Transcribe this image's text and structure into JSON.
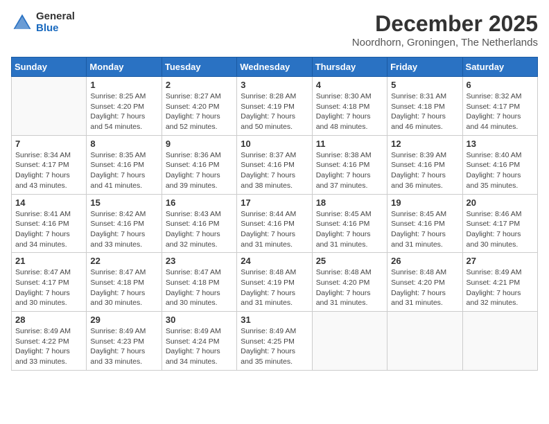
{
  "logo": {
    "general": "General",
    "blue": "Blue"
  },
  "title": "December 2025",
  "subtitle": "Noordhorn, Groningen, The Netherlands",
  "days_of_week": [
    "Sunday",
    "Monday",
    "Tuesday",
    "Wednesday",
    "Thursday",
    "Friday",
    "Saturday"
  ],
  "weeks": [
    [
      {
        "day": "",
        "sunrise": "",
        "sunset": "",
        "daylight": ""
      },
      {
        "day": "1",
        "sunrise": "Sunrise: 8:25 AM",
        "sunset": "Sunset: 4:20 PM",
        "daylight": "Daylight: 7 hours and 54 minutes."
      },
      {
        "day": "2",
        "sunrise": "Sunrise: 8:27 AM",
        "sunset": "Sunset: 4:20 PM",
        "daylight": "Daylight: 7 hours and 52 minutes."
      },
      {
        "day": "3",
        "sunrise": "Sunrise: 8:28 AM",
        "sunset": "Sunset: 4:19 PM",
        "daylight": "Daylight: 7 hours and 50 minutes."
      },
      {
        "day": "4",
        "sunrise": "Sunrise: 8:30 AM",
        "sunset": "Sunset: 4:18 PM",
        "daylight": "Daylight: 7 hours and 48 minutes."
      },
      {
        "day": "5",
        "sunrise": "Sunrise: 8:31 AM",
        "sunset": "Sunset: 4:18 PM",
        "daylight": "Daylight: 7 hours and 46 minutes."
      },
      {
        "day": "6",
        "sunrise": "Sunrise: 8:32 AM",
        "sunset": "Sunset: 4:17 PM",
        "daylight": "Daylight: 7 hours and 44 minutes."
      }
    ],
    [
      {
        "day": "7",
        "sunrise": "Sunrise: 8:34 AM",
        "sunset": "Sunset: 4:17 PM",
        "daylight": "Daylight: 7 hours and 43 minutes."
      },
      {
        "day": "8",
        "sunrise": "Sunrise: 8:35 AM",
        "sunset": "Sunset: 4:16 PM",
        "daylight": "Daylight: 7 hours and 41 minutes."
      },
      {
        "day": "9",
        "sunrise": "Sunrise: 8:36 AM",
        "sunset": "Sunset: 4:16 PM",
        "daylight": "Daylight: 7 hours and 39 minutes."
      },
      {
        "day": "10",
        "sunrise": "Sunrise: 8:37 AM",
        "sunset": "Sunset: 4:16 PM",
        "daylight": "Daylight: 7 hours and 38 minutes."
      },
      {
        "day": "11",
        "sunrise": "Sunrise: 8:38 AM",
        "sunset": "Sunset: 4:16 PM",
        "daylight": "Daylight: 7 hours and 37 minutes."
      },
      {
        "day": "12",
        "sunrise": "Sunrise: 8:39 AM",
        "sunset": "Sunset: 4:16 PM",
        "daylight": "Daylight: 7 hours and 36 minutes."
      },
      {
        "day": "13",
        "sunrise": "Sunrise: 8:40 AM",
        "sunset": "Sunset: 4:16 PM",
        "daylight": "Daylight: 7 hours and 35 minutes."
      }
    ],
    [
      {
        "day": "14",
        "sunrise": "Sunrise: 8:41 AM",
        "sunset": "Sunset: 4:16 PM",
        "daylight": "Daylight: 7 hours and 34 minutes."
      },
      {
        "day": "15",
        "sunrise": "Sunrise: 8:42 AM",
        "sunset": "Sunset: 4:16 PM",
        "daylight": "Daylight: 7 hours and 33 minutes."
      },
      {
        "day": "16",
        "sunrise": "Sunrise: 8:43 AM",
        "sunset": "Sunset: 4:16 PM",
        "daylight": "Daylight: 7 hours and 32 minutes."
      },
      {
        "day": "17",
        "sunrise": "Sunrise: 8:44 AM",
        "sunset": "Sunset: 4:16 PM",
        "daylight": "Daylight: 7 hours and 31 minutes."
      },
      {
        "day": "18",
        "sunrise": "Sunrise: 8:45 AM",
        "sunset": "Sunset: 4:16 PM",
        "daylight": "Daylight: 7 hours and 31 minutes."
      },
      {
        "day": "19",
        "sunrise": "Sunrise: 8:45 AM",
        "sunset": "Sunset: 4:16 PM",
        "daylight": "Daylight: 7 hours and 31 minutes."
      },
      {
        "day": "20",
        "sunrise": "Sunrise: 8:46 AM",
        "sunset": "Sunset: 4:17 PM",
        "daylight": "Daylight: 7 hours and 30 minutes."
      }
    ],
    [
      {
        "day": "21",
        "sunrise": "Sunrise: 8:47 AM",
        "sunset": "Sunset: 4:17 PM",
        "daylight": "Daylight: 7 hours and 30 minutes."
      },
      {
        "day": "22",
        "sunrise": "Sunrise: 8:47 AM",
        "sunset": "Sunset: 4:18 PM",
        "daylight": "Daylight: 7 hours and 30 minutes."
      },
      {
        "day": "23",
        "sunrise": "Sunrise: 8:47 AM",
        "sunset": "Sunset: 4:18 PM",
        "daylight": "Daylight: 7 hours and 30 minutes."
      },
      {
        "day": "24",
        "sunrise": "Sunrise: 8:48 AM",
        "sunset": "Sunset: 4:19 PM",
        "daylight": "Daylight: 7 hours and 31 minutes."
      },
      {
        "day": "25",
        "sunrise": "Sunrise: 8:48 AM",
        "sunset": "Sunset: 4:20 PM",
        "daylight": "Daylight: 7 hours and 31 minutes."
      },
      {
        "day": "26",
        "sunrise": "Sunrise: 8:48 AM",
        "sunset": "Sunset: 4:20 PM",
        "daylight": "Daylight: 7 hours and 31 minutes."
      },
      {
        "day": "27",
        "sunrise": "Sunrise: 8:49 AM",
        "sunset": "Sunset: 4:21 PM",
        "daylight": "Daylight: 7 hours and 32 minutes."
      }
    ],
    [
      {
        "day": "28",
        "sunrise": "Sunrise: 8:49 AM",
        "sunset": "Sunset: 4:22 PM",
        "daylight": "Daylight: 7 hours and 33 minutes."
      },
      {
        "day": "29",
        "sunrise": "Sunrise: 8:49 AM",
        "sunset": "Sunset: 4:23 PM",
        "daylight": "Daylight: 7 hours and 33 minutes."
      },
      {
        "day": "30",
        "sunrise": "Sunrise: 8:49 AM",
        "sunset": "Sunset: 4:24 PM",
        "daylight": "Daylight: 7 hours and 34 minutes."
      },
      {
        "day": "31",
        "sunrise": "Sunrise: 8:49 AM",
        "sunset": "Sunset: 4:25 PM",
        "daylight": "Daylight: 7 hours and 35 minutes."
      },
      {
        "day": "",
        "sunrise": "",
        "sunset": "",
        "daylight": ""
      },
      {
        "day": "",
        "sunrise": "",
        "sunset": "",
        "daylight": ""
      },
      {
        "day": "",
        "sunrise": "",
        "sunset": "",
        "daylight": ""
      }
    ]
  ]
}
